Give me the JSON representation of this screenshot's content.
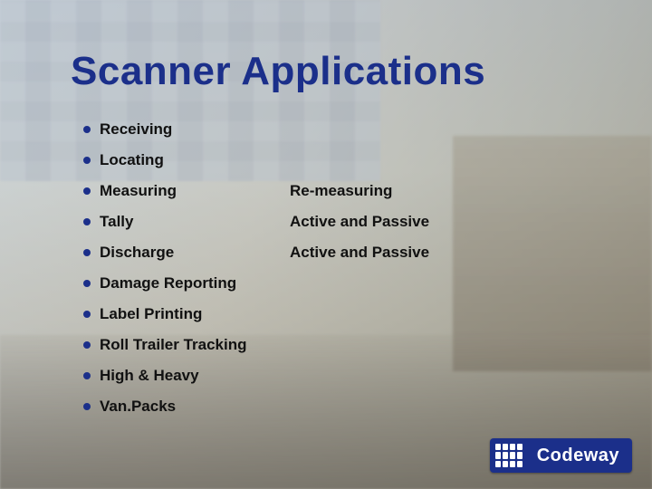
{
  "title": "Scanner Applications",
  "items": [
    {
      "label": "Receiving",
      "desc": ""
    },
    {
      "label": "Locating",
      "desc": ""
    },
    {
      "label": "Measuring",
      "desc": "Re-measuring"
    },
    {
      "label": "Tally",
      "desc": "Active and Passive"
    },
    {
      "label": "Discharge",
      "desc": "Active and Passive"
    },
    {
      "label": "Damage Reporting",
      "desc": ""
    },
    {
      "label": "Label Printing",
      "desc": ""
    },
    {
      "label": "Roll Trailer Tracking",
      "desc": ""
    },
    {
      "label": "High & Heavy",
      "desc": ""
    },
    {
      "label": "Van.Packs",
      "desc": ""
    }
  ],
  "logo": {
    "text": "Codeway"
  }
}
